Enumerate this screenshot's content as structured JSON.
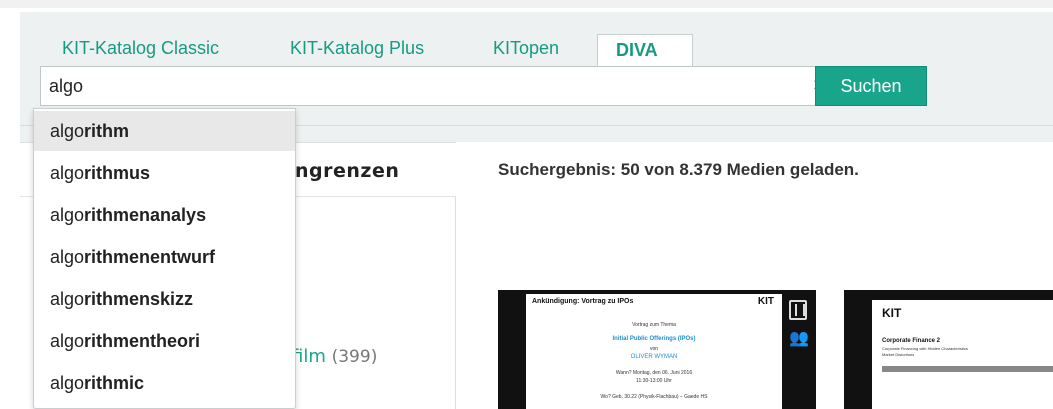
{
  "tabs": [
    "KIT-Katalog Classic",
    "KIT-Katalog Plus",
    "KITopen",
    "DIVA"
  ],
  "active_tab": "DIVA",
  "search": {
    "value": "algo",
    "clear_icon": "close-icon",
    "button_label": "Suchen"
  },
  "suggestions": [
    {
      "typed": "algo",
      "rest": "rithm"
    },
    {
      "typed": "algo",
      "rest": "rithmus"
    },
    {
      "typed": "algo",
      "rest": "rithmenanalys"
    },
    {
      "typed": "algo",
      "rest": "rithmenentwurf"
    },
    {
      "typed": "algo",
      "rest": "rithmenskizz"
    },
    {
      "typed": "algo",
      "rest": "rithmentheori"
    },
    {
      "typed": "algo",
      "rest": "rithmic"
    }
  ],
  "sidebar": {
    "heading_fragment": "ingrenzen",
    "film_label": "film",
    "film_count": "(399)"
  },
  "results": {
    "summary": "Suchergebnis: 50 von 8.379 Medien geladen.",
    "thumb1": {
      "title": "Ankündigung: Vortrag zu IPOs",
      "logo": "KIT",
      "line1": "Vortrag zum Thema",
      "line2": "Initial Public Offerings (IPOs)",
      "line3": "von",
      "line4": "OLIVER WYMAN",
      "line5": "Wann? Montag, den 06. Juni 2016",
      "line6": "11:30-13:00 Uhr",
      "line7": "Wo? Geb. 30.22 (Physik-Flachbau) – Gaede HS"
    },
    "thumb2": {
      "logo": "KIT",
      "title": "Corporate Finance 2",
      "subtitle": "Corporate Financing with Hidden Characteristics",
      "subtitle2": "Market Distortions"
    }
  },
  "colors": {
    "accent": "#18a58b",
    "tab_text": "#159b84",
    "highlight": "#e8e8e8"
  }
}
